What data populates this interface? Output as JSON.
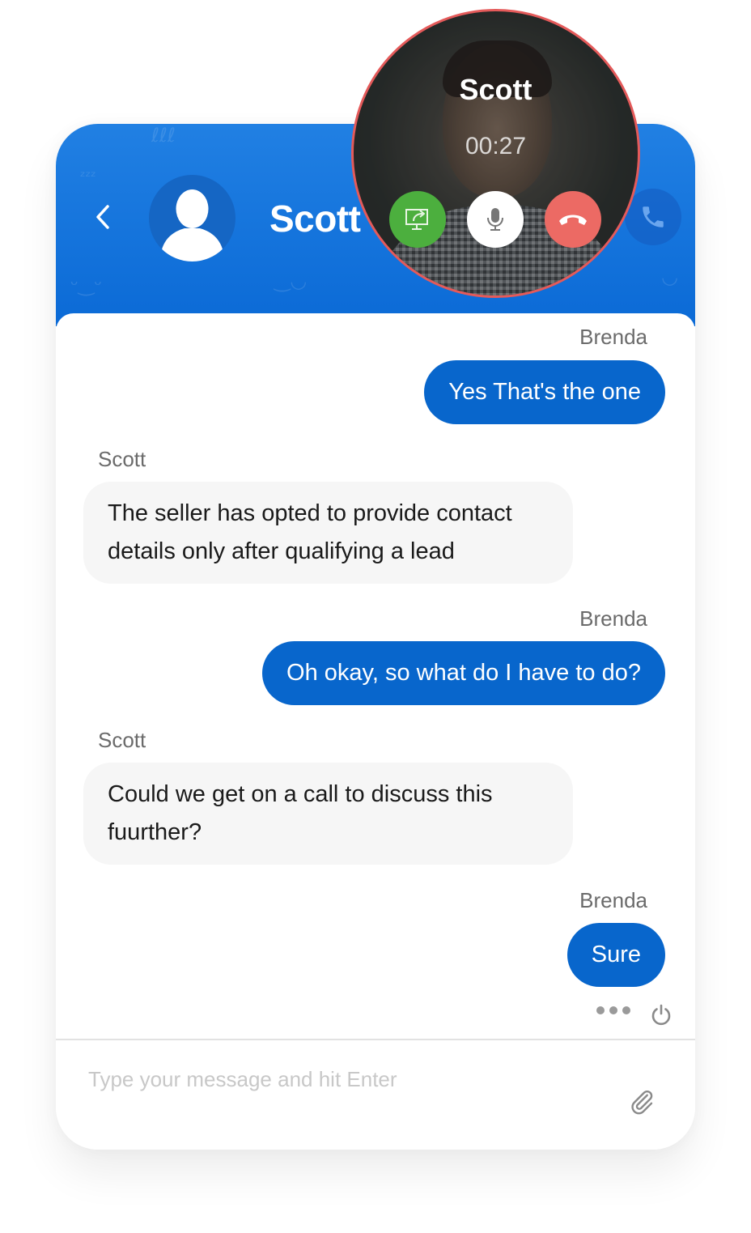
{
  "header": {
    "contact_name": "Scott",
    "back_icon": "chevron-left-icon",
    "avatar_icon": "user-silhouette-icon",
    "call_icon": "phone-icon"
  },
  "call_overlay": {
    "caller_name": "Scott",
    "duration": "00:27",
    "buttons": [
      {
        "name": "share-screen",
        "icon": "screen-share-icon",
        "color": "#4caf3e"
      },
      {
        "name": "mute",
        "icon": "microphone-icon",
        "color": "#ffffff"
      },
      {
        "name": "end-call",
        "icon": "hang-up-icon",
        "color": "#ec6a64"
      }
    ],
    "border_color": "#e45a5a"
  },
  "messages": [
    {
      "sender": "Brenda",
      "direction": "outgoing",
      "text": "Yes That's the one"
    },
    {
      "sender": "Scott",
      "direction": "incoming",
      "text": "The seller has opted to provide contact details only after qualifying a lead"
    },
    {
      "sender": "Brenda",
      "direction": "outgoing",
      "text": "Oh okay, so what do I have to do?"
    },
    {
      "sender": "Scott",
      "direction": "incoming",
      "text": "Could we get on a call to discuss this fuurther?"
    },
    {
      "sender": "Brenda",
      "direction": "outgoing",
      "text": "Sure"
    }
  ],
  "footer": {
    "more_icon": "more-dots-icon",
    "power_icon": "power-icon",
    "composer_placeholder": "Type your message and hit Enter",
    "composer_value": "",
    "attach_icon": "paperclip-icon"
  },
  "colors": {
    "header_blue": "#0b6ad6",
    "outgoing_bubble": "#0866cc",
    "incoming_bubble": "#f6f6f6"
  }
}
